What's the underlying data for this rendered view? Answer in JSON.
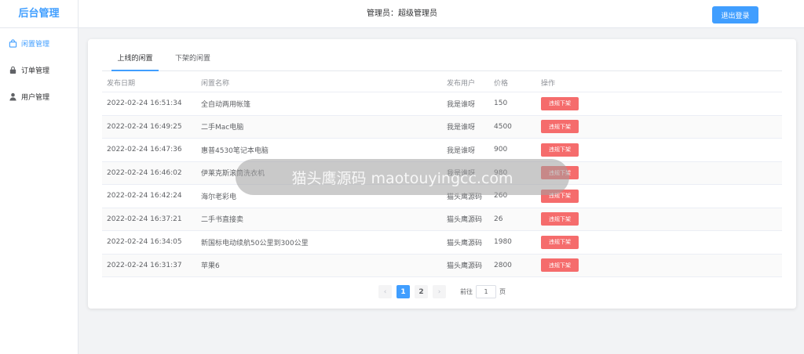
{
  "app": {
    "logo": "后台管理",
    "admin_label": "管理员：超级管理员",
    "logout_label": "退出登录"
  },
  "sidebar": {
    "items": [
      {
        "label": "闲置管理",
        "icon": "bag-icon",
        "active": true
      },
      {
        "label": "订单管理",
        "icon": "lock-icon",
        "active": false
      },
      {
        "label": "用户管理",
        "icon": "user-icon",
        "active": false
      }
    ]
  },
  "tabs": [
    {
      "label": "上线的闲置",
      "active": true
    },
    {
      "label": "下架的闲置",
      "active": false
    }
  ],
  "table": {
    "columns": [
      "发布日期",
      "闲置名称",
      "发布用户",
      "价格",
      "操作"
    ],
    "action_label": "违规下架",
    "rows": [
      {
        "date": "2022-02-24 16:51:34",
        "name": "全自动两用帐篷",
        "user": "我是谁呀",
        "price": "150"
      },
      {
        "date": "2022-02-24 16:49:25",
        "name": "二手Mac电脑",
        "user": "我是谁呀",
        "price": "4500"
      },
      {
        "date": "2022-02-24 16:47:36",
        "name": "惠普4530笔记本电脑",
        "user": "我是谁呀",
        "price": "900"
      },
      {
        "date": "2022-02-24 16:46:02",
        "name": "伊莱克斯滚筒洗衣机",
        "user": "我是谁呀",
        "price": "980"
      },
      {
        "date": "2022-02-24 16:42:24",
        "name": "海尔老彩电",
        "user": "猫头鹰源码",
        "price": "260"
      },
      {
        "date": "2022-02-24 16:37:21",
        "name": "二手书直接卖",
        "user": "猫头鹰源码",
        "price": "26"
      },
      {
        "date": "2022-02-24 16:34:05",
        "name": "新国标电动续航50公里到300公里",
        "user": "猫头鹰源码",
        "price": "1980"
      },
      {
        "date": "2022-02-24 16:31:37",
        "name": "苹果6",
        "user": "猫头鹰源码",
        "price": "2800"
      }
    ]
  },
  "pagination": {
    "prev": "‹",
    "next": "›",
    "pages": [
      "1",
      "2"
    ],
    "current": "1",
    "goto_label": "前往",
    "goto_value": "1",
    "goto_suffix": "页"
  },
  "watermark": {
    "text": "猫头鹰源码 maotouyingcc.com"
  },
  "colors": {
    "primary": "#409eff",
    "danger": "#f56c6c"
  }
}
